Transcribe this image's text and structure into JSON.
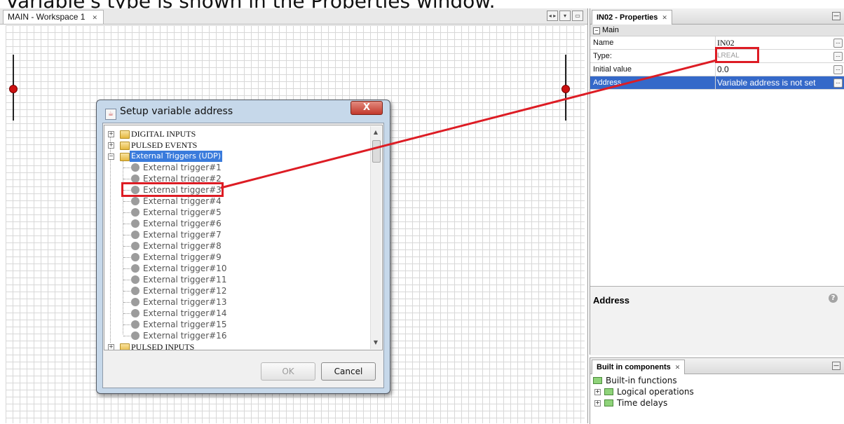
{
  "caption": "Variable's type is shown in the Properties window.",
  "editor": {
    "tab_label": "MAIN - Workspace 1",
    "tab_close": "✕",
    "controls": [
      "◂ ▸",
      "▾",
      "▭"
    ]
  },
  "properties": {
    "title": "IN02 - Properties",
    "close": "✕",
    "minimize": "—",
    "section": "Main",
    "section_toggle": "−",
    "rows": [
      {
        "key": "Name",
        "value": "IN02",
        "more": "..."
      },
      {
        "key": "Type:",
        "value": "LREAL",
        "more": "..."
      },
      {
        "key": "Initial value",
        "value": "0.0",
        "more": "..."
      },
      {
        "key": "Address",
        "value": "Variable address is not set",
        "more": "..."
      }
    ],
    "description_title": "Address",
    "help": "?"
  },
  "components": {
    "title": "Built in components",
    "close": "✕",
    "minimize": "—",
    "items": [
      {
        "label": "Built-in functions",
        "expander": ""
      },
      {
        "label": "Logical operations",
        "expander": "+"
      },
      {
        "label": "Time delays",
        "expander": "+"
      }
    ]
  },
  "dialog": {
    "title": "Setup variable address",
    "close": "X",
    "app_icon": "☕",
    "tree": [
      {
        "label": "DIGITAL INPUTS",
        "expander": "+"
      },
      {
        "label": "PULSED EVENTS",
        "expander": "+"
      },
      {
        "label": "External Triggers (UDP)",
        "expander": "−"
      },
      {
        "label": "External trigger#1"
      },
      {
        "label": "External trigger#2"
      },
      {
        "label": "External trigger#3"
      },
      {
        "label": "External trigger#4"
      },
      {
        "label": "External trigger#5"
      },
      {
        "label": "External trigger#6"
      },
      {
        "label": "External trigger#7"
      },
      {
        "label": "External trigger#8"
      },
      {
        "label": "External trigger#9"
      },
      {
        "label": "External trigger#10"
      },
      {
        "label": "External trigger#11"
      },
      {
        "label": "External trigger#12"
      },
      {
        "label": "External trigger#13"
      },
      {
        "label": "External trigger#14"
      },
      {
        "label": "External trigger#15"
      },
      {
        "label": "External trigger#16"
      },
      {
        "label": "PULSED INPUTS",
        "expander": "+"
      }
    ],
    "scroll_up": "▲",
    "scroll_down": "▼",
    "ok_label": "OK",
    "cancel_label": "Cancel"
  },
  "colors": {
    "annotation": "#dd1c24",
    "selection": "#3569c9"
  }
}
